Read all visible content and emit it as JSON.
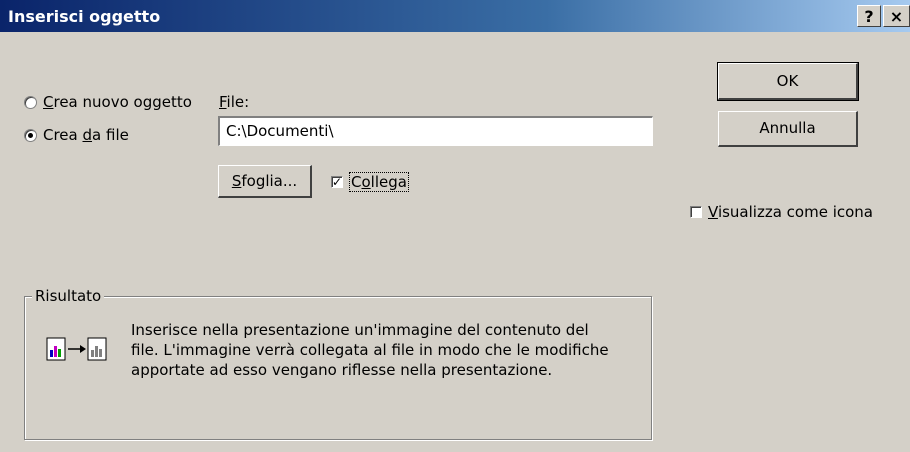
{
  "window": {
    "title": "Inserisci oggetto",
    "help_label": "?",
    "close_label": "×"
  },
  "options": {
    "create_new": {
      "prefix": "",
      "accel": "C",
      "rest": "rea nuovo oggetto",
      "checked": false
    },
    "create_from_file": {
      "prefix": "Crea ",
      "accel": "d",
      "rest": "a file",
      "checked": true
    }
  },
  "file": {
    "label_accel": "F",
    "label_rest": "ile:",
    "value": "C:\\Documenti\\"
  },
  "browse_button": {
    "accel": "S",
    "rest": "foglia..."
  },
  "link_checkbox": {
    "prefix": "C",
    "accel": "o",
    "rest": "llega",
    "checked": true,
    "check_glyph": "✓"
  },
  "buttons": {
    "ok": "OK",
    "cancel": "Annulla"
  },
  "display_as_icon": {
    "accel": "V",
    "rest": "isualizza come icona",
    "checked": false
  },
  "result": {
    "legend": "Risultato",
    "lines": [
      "Inserisce nella presentazione un'immagine del contenuto del",
      "file. L'immagine verrà collegata al file in modo che le modifiche",
      "apportate ad esso vengano riflesse nella presentazione."
    ]
  }
}
